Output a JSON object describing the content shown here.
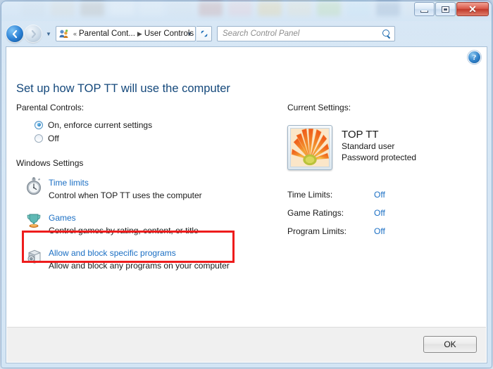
{
  "window": {
    "controls": {
      "minimize": "–",
      "maximize": "▢",
      "close": "✕"
    }
  },
  "addressbar": {
    "back_glyph": "←",
    "forward_glyph": "→",
    "dropdown_glyph": "▼",
    "icon_name": "parental-controls-icon",
    "prefix": "«",
    "separator": "▶",
    "crumb1": "Parental Cont...",
    "crumb2": "User Controls",
    "caret_glyph": "▼",
    "refresh_glyph": "↯"
  },
  "search": {
    "placeholder": "Search Control Panel",
    "icon_name": "search-icon"
  },
  "help": {
    "label": "?"
  },
  "main": {
    "heading": "Set up how TOP TT will use the computer",
    "parental_controls_label": "Parental Controls:",
    "radios": [
      {
        "label": "On, enforce current settings",
        "selected": true
      },
      {
        "label": "Off",
        "selected": false
      }
    ],
    "windows_settings_label": "Windows Settings",
    "items": [
      {
        "icon": "stopwatch-icon",
        "title": "Time limits",
        "desc": "Control when TOP TT uses the computer",
        "highlighted": true
      },
      {
        "icon": "trophy-icon",
        "title": "Games",
        "desc": "Control games by rating, content, or title",
        "highlighted": false
      },
      {
        "icon": "programs-box-icon",
        "title": "Allow and block specific programs",
        "desc": "Allow and block any programs on your computer",
        "highlighted": false
      }
    ]
  },
  "current_settings": {
    "label": "Current Settings:",
    "avatar_name": "user-avatar-flower",
    "username": "TOP TT",
    "account_type": "Standard user",
    "password_state": "Password protected",
    "rows": [
      {
        "label": "Time Limits:",
        "value": "Off"
      },
      {
        "label": "Game Ratings:",
        "value": "Off"
      },
      {
        "label": "Program Limits:",
        "value": "Off"
      }
    ]
  },
  "footer": {
    "ok_label": "OK"
  },
  "colors": {
    "heading_blue": "#14487b",
    "link_blue": "#1b6fc4",
    "highlight_red": "#ee1c1c",
    "status_blue": "#1b6fc4"
  },
  "desktop_icon_colors": [
    "#b9c9d8",
    "#c9c3b4",
    "#8f8272",
    "#e8eef4",
    "#dbe6f0",
    "#c4d2de",
    "#a85046",
    "#e3a3ad",
    "#e0b13f",
    "#ddd0a4",
    "#8fc65a",
    "#a9d6ee",
    "#4a6f9e",
    "#cfd7e2",
    "#7fa86a",
    "#8e6fa8"
  ]
}
